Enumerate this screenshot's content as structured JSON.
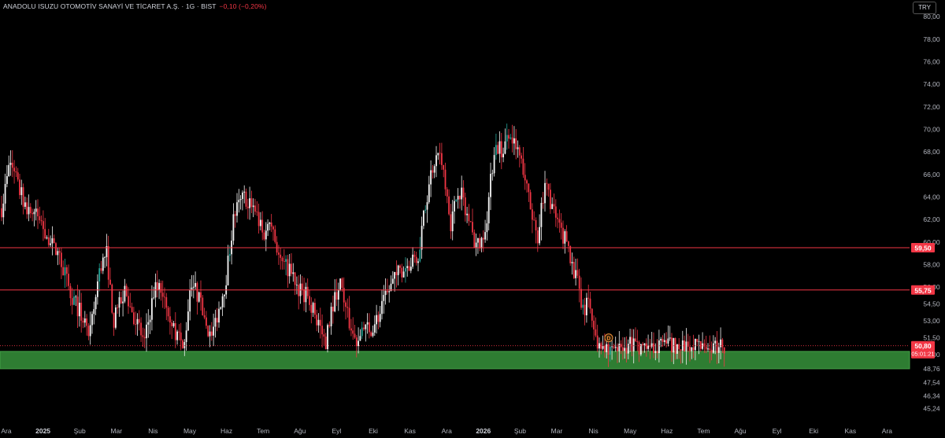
{
  "header": {
    "title": "ANADOLU ISUZU OTOMOTİV SANAYİ VE TİCARET A.Ş. · 1G · BIST",
    "change": "−0,10 (−0,20%)"
  },
  "currency_button": "TRY",
  "colors": {
    "background": "#000000",
    "up": "#f5f5f5",
    "up_alt": "#26a69a",
    "down": "#f23645",
    "level_line": "#f23645",
    "zone_fill": "#2e7d32",
    "zone_border": "#43a047",
    "event_badge": "#f29339"
  },
  "chart_data": {
    "type": "candlestick",
    "timeframe": "1G",
    "currency": "TRY",
    "ylim": [
      44.5,
      80.5
    ],
    "y_ticks": [
      "80,00",
      "78,00",
      "76,00",
      "74,00",
      "72,00",
      "70,00",
      "68,00",
      "66,00",
      "64,00",
      "62,00",
      "60,00",
      "58,00",
      "56,00",
      "54,50",
      "53,00",
      "51,50",
      "50,00",
      "48,76",
      "47,54",
      "46,34",
      "45,24"
    ],
    "x_ticks": [
      {
        "label": "Ara",
        "bold": false
      },
      {
        "label": "2025",
        "bold": true
      },
      {
        "label": "Şub",
        "bold": false
      },
      {
        "label": "Mar",
        "bold": false
      },
      {
        "label": "Nis",
        "bold": false
      },
      {
        "label": "May",
        "bold": false
      },
      {
        "label": "Haz",
        "bold": false
      },
      {
        "label": "Tem",
        "bold": false
      },
      {
        "label": "Ağu",
        "bold": false
      },
      {
        "label": "Eyl",
        "bold": false
      },
      {
        "label": "Eki",
        "bold": false
      },
      {
        "label": "Kas",
        "bold": false
      },
      {
        "label": "Ara",
        "bold": false
      },
      {
        "label": "2026",
        "bold": true
      },
      {
        "label": "Şub",
        "bold": false
      },
      {
        "label": "Mar",
        "bold": false
      },
      {
        "label": "Nis",
        "bold": false
      },
      {
        "label": "May",
        "bold": false
      },
      {
        "label": "Haz",
        "bold": false
      },
      {
        "label": "Tem",
        "bold": false
      },
      {
        "label": "Ağu",
        "bold": false
      },
      {
        "label": "Eyl",
        "bold": false
      },
      {
        "label": "Eki",
        "bold": false
      },
      {
        "label": "Kas",
        "bold": false
      },
      {
        "label": "Ara",
        "bold": false
      }
    ],
    "price_path": [
      [
        0,
        63.0
      ],
      [
        0.012,
        67.2
      ],
      [
        0.025,
        64.5
      ],
      [
        0.038,
        62.8
      ],
      [
        0.052,
        62.2
      ],
      [
        0.065,
        60.2
      ],
      [
        0.08,
        58.8
      ],
      [
        0.095,
        55.5
      ],
      [
        0.108,
        53.8
      ],
      [
        0.122,
        51.5
      ],
      [
        0.135,
        57.2
      ],
      [
        0.145,
        59.2
      ],
      [
        0.155,
        53.0
      ],
      [
        0.17,
        55.5
      ],
      [
        0.185,
        53.2
      ],
      [
        0.198,
        51.2
      ],
      [
        0.212,
        56.0
      ],
      [
        0.225,
        55.5
      ],
      [
        0.238,
        52.5
      ],
      [
        0.252,
        50.2
      ],
      [
        0.262,
        56.8
      ],
      [
        0.275,
        54.5
      ],
      [
        0.29,
        51.5
      ],
      [
        0.3,
        54.0
      ],
      [
        0.31,
        56.5
      ],
      [
        0.322,
        62.5
      ],
      [
        0.335,
        64.0
      ],
      [
        0.348,
        63.5
      ],
      [
        0.362,
        60.5
      ],
      [
        0.372,
        62.5
      ],
      [
        0.385,
        58.2
      ],
      [
        0.398,
        57.5
      ],
      [
        0.41,
        56.0
      ],
      [
        0.425,
        55.0
      ],
      [
        0.438,
        53.0
      ],
      [
        0.448,
        51.0
      ],
      [
        0.458,
        54.5
      ],
      [
        0.468,
        56.5
      ],
      [
        0.478,
        53.5
      ],
      [
        0.49,
        51.2
      ],
      [
        0.5,
        52.0
      ],
      [
        0.512,
        52.5
      ],
      [
        0.522,
        53.5
      ],
      [
        0.535,
        55.5
      ],
      [
        0.548,
        57.2
      ],
      [
        0.562,
        58.0
      ],
      [
        0.575,
        58.5
      ],
      [
        0.585,
        62.5
      ],
      [
        0.595,
        66.5
      ],
      [
        0.605,
        68.0
      ],
      [
        0.613,
        66.0
      ],
      [
        0.622,
        61.5
      ],
      [
        0.632,
        65.0
      ],
      [
        0.642,
        63.0
      ],
      [
        0.652,
        60.5
      ],
      [
        0.662,
        59.5
      ],
      [
        0.672,
        62.5
      ],
      [
        0.682,
        68.5
      ],
      [
        0.692,
        68.2
      ],
      [
        0.702,
        69.2
      ],
      [
        0.712,
        68.5
      ],
      [
        0.722,
        66.5
      ],
      [
        0.732,
        63.0
      ],
      [
        0.742,
        60.5
      ],
      [
        0.752,
        65.5
      ],
      [
        0.762,
        63.0
      ],
      [
        0.772,
        61.0
      ],
      [
        0.782,
        60.0
      ],
      [
        0.79,
        58.0
      ],
      [
        0.798,
        56.0
      ],
      [
        0.805,
        53.5
      ],
      [
        0.812,
        55.0
      ],
      [
        0.818,
        53.0
      ],
      [
        0.824,
        51.0
      ],
      [
        0.83,
        50.8
      ]
    ],
    "levels": [
      {
        "price": 59.5,
        "label": "59,50"
      },
      {
        "price": 55.75,
        "label": "55,75"
      }
    ],
    "support_zone": {
      "low": 48.76,
      "high": 50.3
    },
    "last_price": {
      "value": "50,80",
      "countdown": "05:01:21"
    },
    "event_marker": {
      "label": "D",
      "date_frac": 0.838,
      "price": 51.5
    }
  }
}
